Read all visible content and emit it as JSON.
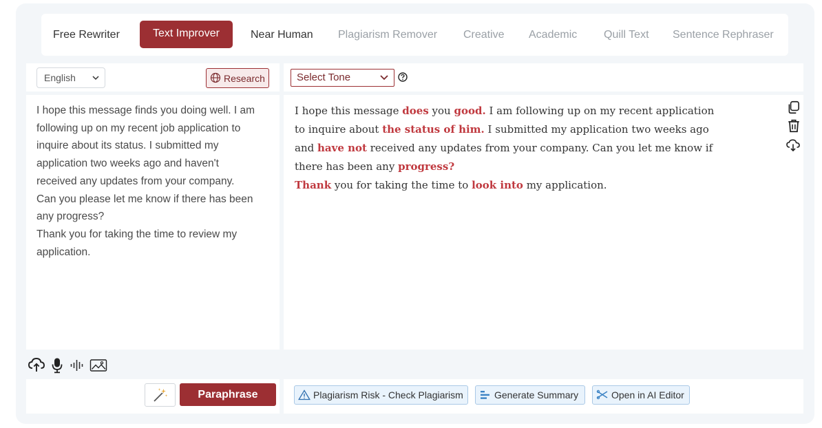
{
  "tabs": [
    {
      "label": "Free Rewriter",
      "state": "dark"
    },
    {
      "label": "Text Improver",
      "state": "active"
    },
    {
      "label": "Near Human",
      "state": "dark"
    },
    {
      "label": "Plagiarism Remover",
      "state": "muted"
    },
    {
      "label": "Creative",
      "state": "muted"
    },
    {
      "label": "Academic",
      "state": "muted"
    },
    {
      "label": "Quill Text",
      "state": "muted"
    },
    {
      "label": "Sentence Rephraser",
      "state": "muted"
    }
  ],
  "input_panel": {
    "language": "English",
    "research_label": "Research",
    "text_lines": [
      "I hope this message finds you doing well. I am",
      "following up on my recent job application to",
      "inquire about its status. I submitted my",
      "application two weeks ago and haven't",
      "received any updates from your company.",
      "Can you please let me know if there has been",
      "any progress?",
      "Thank you for taking the time to review my",
      "application."
    ],
    "tool_icons": [
      "upload-cloud-icon",
      "microphone-icon",
      "audio-wave-icon",
      "image-icon"
    ],
    "magic_icon": "magic-wand-icon",
    "paraphrase_label": "Paraphrase"
  },
  "output_panel": {
    "tone_label": "Select Tone",
    "help_icon": "question-circle-icon",
    "text_lines": [
      [
        [
          "I hope this message ",
          false
        ],
        [
          "does",
          true
        ],
        [
          " you ",
          false
        ],
        [
          "good.",
          true
        ],
        [
          " I am following up on my recent application",
          false
        ]
      ],
      [
        [
          "to inquire about ",
          false
        ],
        [
          "the status of him.",
          true
        ],
        [
          " I submitted my application two weeks ago",
          false
        ]
      ],
      [
        [
          "and ",
          false
        ],
        [
          "have not",
          true
        ],
        [
          " received any updates from your company. Can you let me know if",
          false
        ]
      ],
      [
        [
          "there has been any ",
          false
        ],
        [
          "progress?",
          true
        ]
      ],
      [
        [
          "Thank",
          true
        ],
        [
          " you for taking the time to ",
          false
        ],
        [
          "look into",
          true
        ],
        [
          " my application.",
          false
        ]
      ]
    ],
    "side_icons": [
      "copy-icon",
      "trash-icon",
      "download-cloud-icon"
    ],
    "actions": [
      {
        "label": "Plagiarism Risk - Check Plagiarism",
        "icon": "warning-icon"
      },
      {
        "label": "Generate Summary",
        "icon": "summary-icon"
      },
      {
        "label": "Open in AI Editor",
        "icon": "editor-icon"
      }
    ]
  },
  "colors": {
    "brand": "#9c2f33",
    "highlight": "#c0393f",
    "background": "#f3f6f9",
    "action_border": "#a9c8e6",
    "action_fill": "#e9f3fc"
  }
}
